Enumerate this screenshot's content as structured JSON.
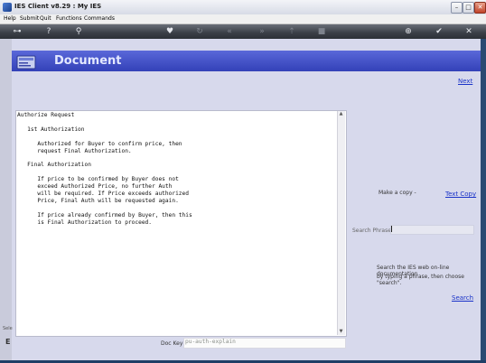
{
  "window": {
    "title": "IES Client v8.29 : My IES",
    "min_glyph": "–",
    "max_glyph": "□",
    "close_glyph": "✕"
  },
  "menu": {
    "help": "Help",
    "submit": "Submit",
    "quit": "Quit",
    "functions": "Functions",
    "commands": "Commands"
  },
  "header": {
    "title": "Document"
  },
  "nav": {
    "next": "Next"
  },
  "document": {
    "text": "Authorize Request\n\n   1st Authorization\n\n      Authorized for Buyer to confirm price, then\n      request Final Authorization.\n\n   Final Authorization\n\n      If price to be confirmed by Buyer does not\n      exceed Authorized Price, no further Auth\n      will be required. If Price exceeds authorized\n      Price, Final Auth will be requested again.\n\n      If price already confirmed by Buyer, then this\n      is Final Authorization to proceed."
  },
  "copy": {
    "label": "Make a copy -",
    "link": "Text Copy"
  },
  "search": {
    "label": "Search Phrase",
    "help_line1": "Search the IES web on-line documentation",
    "help_line2": "by typing a phrase, then choose \"search\".",
    "button": "Search"
  },
  "dockey": {
    "label": "Doc Key",
    "value": "pu-auth-explain"
  },
  "side": {
    "e_glyph": "E",
    "label": "Sele"
  },
  "toolbar_icons": [
    "key-icon",
    "help-icon",
    "search-icon",
    "heart-icon",
    "refresh-icon",
    "rewind-icon",
    "fast-forward-icon",
    "upload-icon",
    "stop-icon",
    "globe-icon",
    "check-icon",
    "close-icon"
  ]
}
